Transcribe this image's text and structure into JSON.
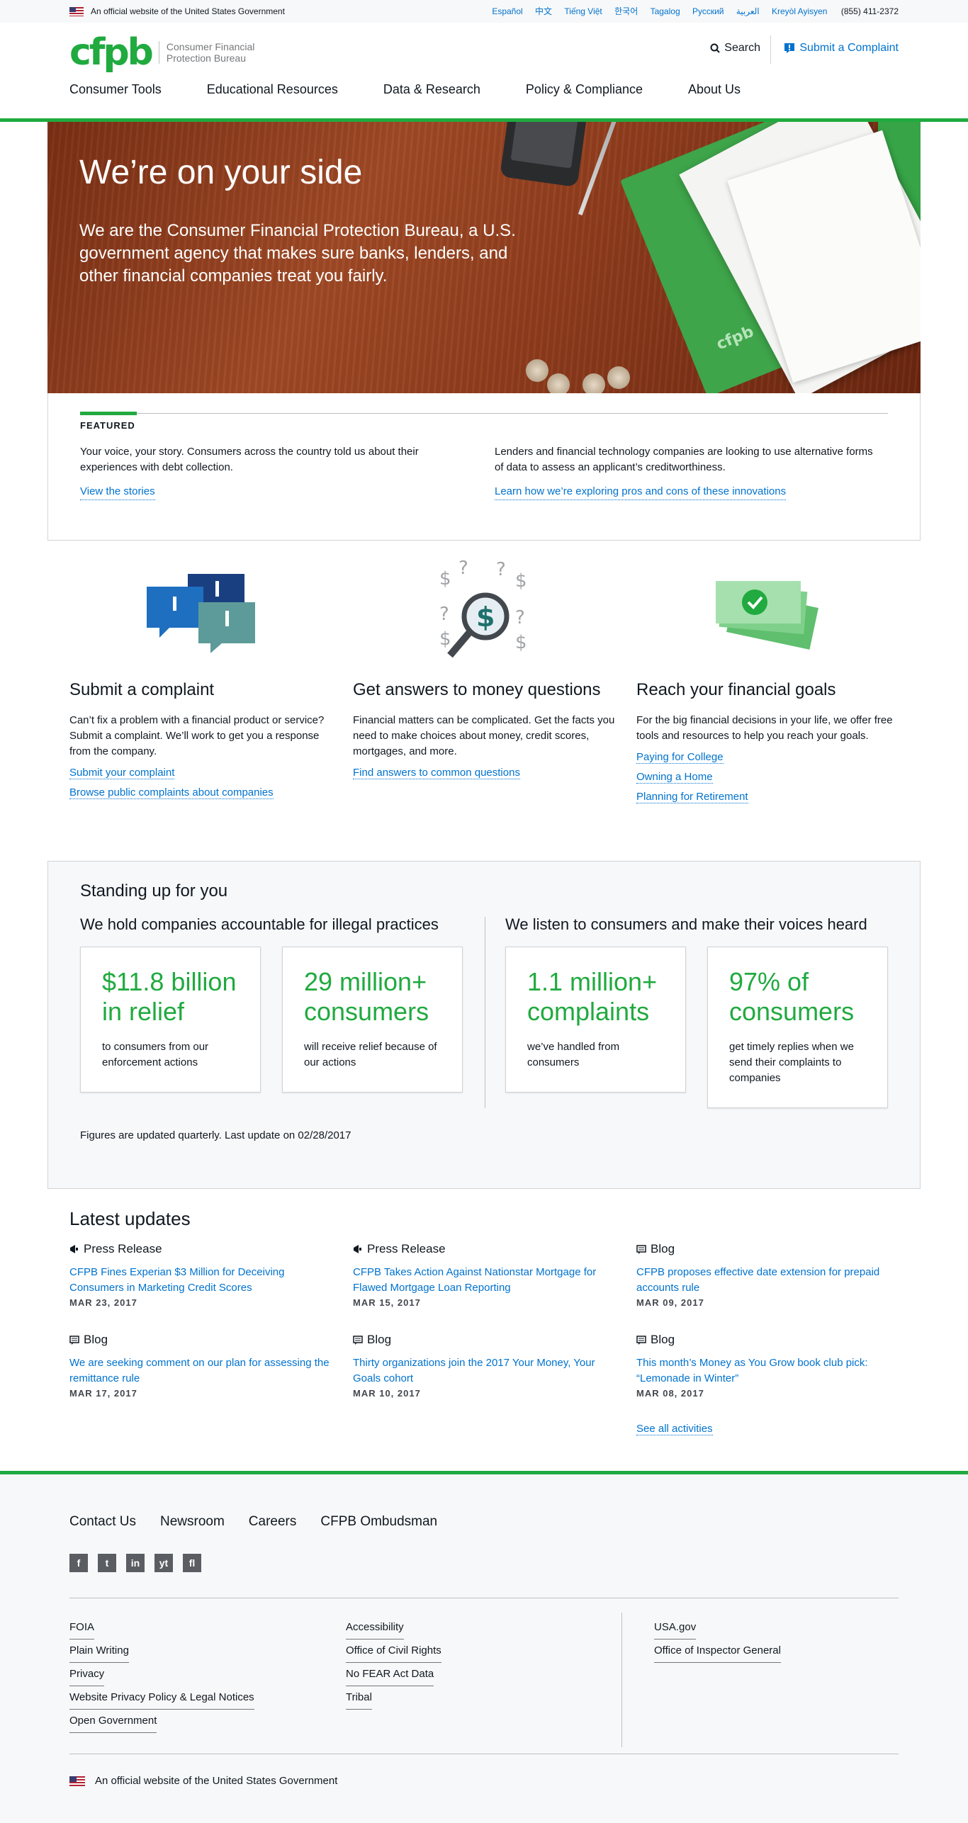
{
  "banner": {
    "official": "An official website of the United States Government",
    "languages": [
      "Español",
      "中文",
      "Tiếng Việt",
      "한국어",
      "Tagalog",
      "Русский",
      "العربية",
      "Kreyòl Ayisyen"
    ],
    "phone": "(855) 411-2372"
  },
  "header": {
    "logo_mark": "cfpb",
    "logo_name_1": "Consumer Financial",
    "logo_name_2": "Protection Bureau",
    "search": "Search",
    "complaint": "Submit a Complaint"
  },
  "nav": [
    "Consumer Tools",
    "Educational Resources",
    "Data & Research",
    "Policy & Compliance",
    "About Us"
  ],
  "hero": {
    "title": "We’re on your side",
    "text": "We are the Consumer Financial Protection Bureau, a U.S. government agency that makes sure banks, lenders, and other financial companies treat you fairly."
  },
  "featured": {
    "label": "FEATURED",
    "items": [
      {
        "text": "Your voice, your story. Consumers across the country told us about their experiences with debt collection.",
        "link": "View the stories"
      },
      {
        "text": "Lenders and financial technology companies are looking to use alternative forms of data to assess an applicant’s creditworthiness.",
        "link": "Learn how we’re exploring pros and cons of these innovations"
      }
    ]
  },
  "services": [
    {
      "title": "Submit a complaint",
      "text": "Can’t fix a problem with a financial product or service? Submit a complaint. We’ll work to get you a response from the company.",
      "links": [
        "Submit your complaint",
        "Browse public complaints about companies"
      ]
    },
    {
      "title": "Get answers to money questions",
      "text": "Financial matters can be complicated. Get the facts you need to make choices about money, credit scores, mortgages, and more.",
      "links": [
        "Find answers to common questions"
      ]
    },
    {
      "title": "Reach your financial goals",
      "text": "For the big financial decisions in your life, we offer free tools and resources to help you reach your goals.",
      "links": [
        "Paying for College",
        "Owning a Home",
        "Planning for Retirement"
      ]
    }
  ],
  "standing": {
    "title": "Standing up for you",
    "left_heading": "We hold companies accountable for illegal practices",
    "right_heading": "We listen to consumers and make their voices heard",
    "stats": [
      {
        "big": "$11.8 billion in relief",
        "small": "to consumers from our enforcement actions"
      },
      {
        "big": "29 million+ consumers",
        "small": "will receive relief because of our actions"
      },
      {
        "big": "1.1 million+ complaints",
        "small": "we’ve handled from consumers"
      },
      {
        "big": "97% of consumers",
        "small": "get timely replies when we send their complaints to companies"
      }
    ],
    "note": "Figures are updated quarterly. Last update on 02/28/2017"
  },
  "latest": {
    "title": "Latest updates",
    "items": [
      {
        "category": "Press Release",
        "title": "CFPB Fines Experian $3 Million for Deceiving Consumers in Marketing Credit Scores",
        "date": "MAR 23, 2017"
      },
      {
        "category": "Press Release",
        "title": "CFPB Takes Action Against Nationstar Mortgage for Flawed Mortgage Loan Reporting",
        "date": "MAR 15, 2017"
      },
      {
        "category": "Blog",
        "title": "CFPB proposes effective date extension for prepaid accounts rule",
        "date": "MAR 09, 2017"
      },
      {
        "category": "Blog",
        "title": "We are seeking comment on our plan for assessing the remittance rule",
        "date": "MAR 17, 2017"
      },
      {
        "category": "Blog",
        "title": "Thirty organizations join the 2017 Your Money, Your Goals cohort",
        "date": "MAR 10, 2017"
      },
      {
        "category": "Blog",
        "title": "This month’s Money as You Grow book club pick: “Lemonade in Winter”",
        "date": "MAR 08, 2017"
      }
    ],
    "see_all": "See all activities"
  },
  "footer": {
    "nav": [
      "Contact Us",
      "Newsroom",
      "Careers",
      "CFPB Ombudsman"
    ],
    "social": [
      "f",
      "t",
      "in",
      "yt",
      "fl"
    ],
    "col1": [
      "FOIA",
      "Plain Writing",
      "Privacy",
      "Website Privacy Policy & Legal Notices",
      "Open Government"
    ],
    "col2": [
      "Accessibility",
      "Office of Civil Rights",
      "No FEAR Act Data",
      "Tribal"
    ],
    "col3": [
      "USA.gov",
      "Office of Inspector General"
    ],
    "official": "An official website of the United States Government"
  },
  "colors": {
    "brand_green": "#20aa3f",
    "link_blue": "#0072ce"
  }
}
